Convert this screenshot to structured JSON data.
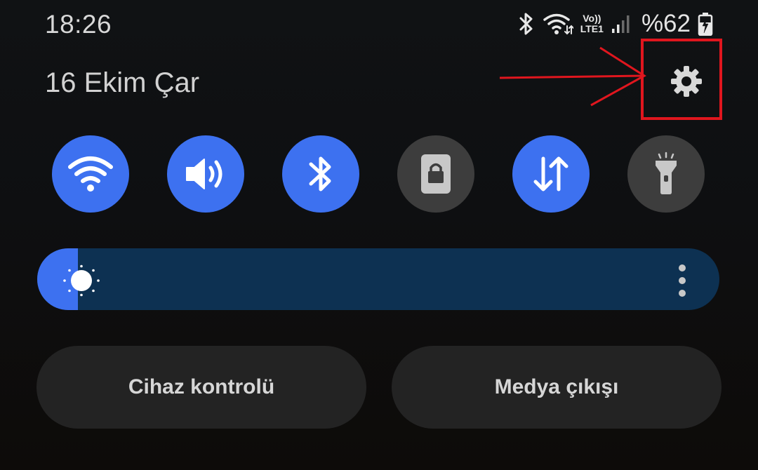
{
  "status_bar": {
    "time": "18:26",
    "volte_top": "Vo))",
    "volte_bottom": "LTE1",
    "battery_percent": "%62",
    "icons": [
      "bluetooth-icon",
      "wifi-icon",
      "volte-lte-icon",
      "signal-icon",
      "battery-charging-icon"
    ]
  },
  "header": {
    "date": "16 Ekim Çar",
    "settings_icon": "gear-icon"
  },
  "quick_toggles": [
    {
      "name": "wifi",
      "icon": "wifi-icon",
      "state": "on"
    },
    {
      "name": "sound",
      "icon": "speaker-icon",
      "state": "on"
    },
    {
      "name": "bluetooth",
      "icon": "bluetooth-icon",
      "state": "on"
    },
    {
      "name": "screen-lock",
      "icon": "lock-icon",
      "state": "off"
    },
    {
      "name": "mobile-data",
      "icon": "data-arrows-icon",
      "state": "on"
    },
    {
      "name": "flashlight",
      "icon": "flashlight-icon",
      "state": "off"
    }
  ],
  "brightness": {
    "level": 0.06,
    "icon": "sun-icon",
    "more_icon": "more-vertical-icon"
  },
  "buttons": {
    "device_control": "Cihaz kontrolü",
    "media_output": "Medya çıkışı"
  },
  "colors": {
    "accent": "#3d71f0",
    "tile_off": "#3d3d3d",
    "slider_track": "#0d3152",
    "pill_bg": "#232323",
    "annotation": "#e0161e"
  }
}
